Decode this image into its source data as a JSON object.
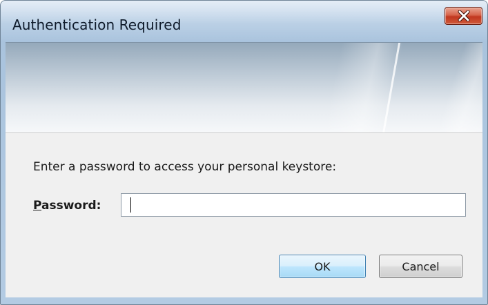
{
  "window": {
    "title": "Authentication Required",
    "close_icon": "close-icon"
  },
  "form": {
    "prompt": "Enter a password to access your personal keystore:",
    "password_label_first": "P",
    "password_label_rest": "assword:",
    "password_value": "",
    "password_placeholder": ""
  },
  "buttons": {
    "ok_label": "OK",
    "cancel_label": "Cancel"
  },
  "colors": {
    "close_button": "#c1371f",
    "ok_border": "#3c7fb1",
    "content_background": "#f0f0f0"
  }
}
